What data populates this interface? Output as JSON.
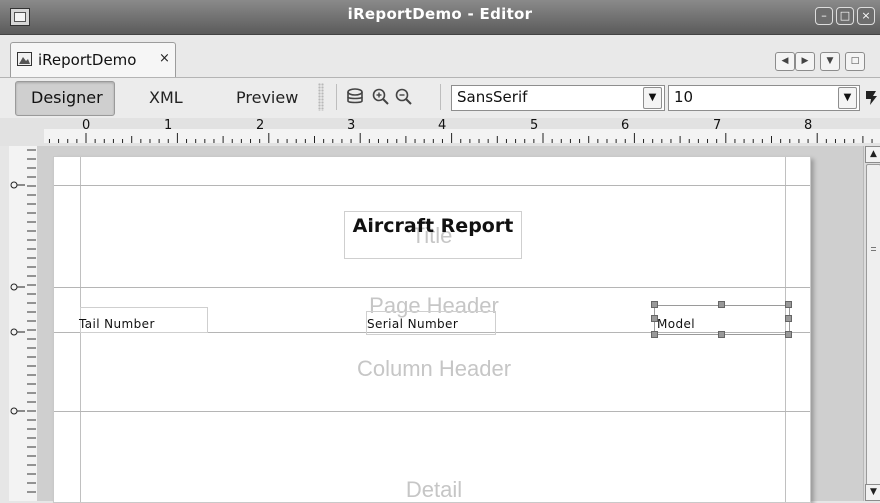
{
  "window": {
    "title": "iReportDemo - Editor"
  },
  "document_tab": {
    "label": "iReportDemo",
    "close": "×"
  },
  "view_tabs": {
    "designer": "Designer",
    "xml": "XML",
    "preview": "Preview"
  },
  "font_combo": {
    "value": "SansSerif"
  },
  "size_combo": {
    "value": "10"
  },
  "ruler": {
    "labels": [
      "0",
      "1",
      "2",
      "3",
      "4",
      "5",
      "6",
      "7",
      "8"
    ]
  },
  "report": {
    "title_text": "Aircraft Report",
    "bands": {
      "title": "Title",
      "page_header": "Page Header",
      "column_header": "Column Header",
      "detail": "Detail"
    },
    "fields": {
      "tail_number": "Tail Number",
      "serial_number": "Serial Number",
      "model": "Model"
    }
  },
  "colors": {
    "titlebar": "#6e6e6e",
    "page": "#ffffff",
    "band_label": "#c6c6c6"
  }
}
